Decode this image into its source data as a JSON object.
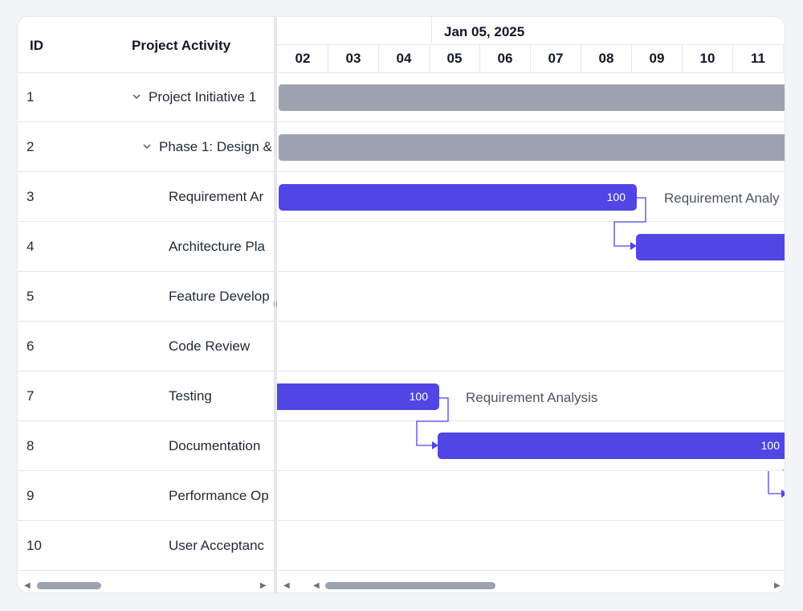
{
  "grid": {
    "columns": {
      "id": "ID",
      "name": "Project Activity"
    },
    "rows": [
      {
        "id": "1",
        "name": "Project Initiative 1",
        "level": 0,
        "expand": "chevron-down"
      },
      {
        "id": "2",
        "name": "Phase 1: Design &",
        "level": 1,
        "expand": "chevron-down"
      },
      {
        "id": "3",
        "name": "Requirement Ar",
        "level": 2
      },
      {
        "id": "4",
        "name": "Architecture Pla",
        "level": 2
      },
      {
        "id": "5",
        "name": "Feature Develop",
        "level": 2
      },
      {
        "id": "6",
        "name": "Code Review",
        "level": 2
      },
      {
        "id": "7",
        "name": "Testing",
        "level": 2
      },
      {
        "id": "8",
        "name": "Documentation",
        "level": 2
      },
      {
        "id": "9",
        "name": "Performance Op",
        "level": 2
      },
      {
        "id": "10",
        "name": "User Acceptanc",
        "level": 2
      }
    ]
  },
  "splitter": {
    "grip": "II"
  },
  "timeline": {
    "week": "Jan 05, 2025",
    "days": [
      "02",
      "03",
      "04",
      "05",
      "06",
      "07",
      "08",
      "09",
      "10",
      "11"
    ]
  },
  "tasks": [
    {
      "row": 1,
      "type": "summary"
    },
    {
      "row": 2,
      "type": "summary"
    },
    {
      "row": 3,
      "type": "task",
      "progress": "100",
      "label": "Requirement Analy"
    },
    {
      "row": 4,
      "type": "task"
    },
    {
      "row": 7,
      "type": "task",
      "progress": "100",
      "label": "Requirement Analysis"
    },
    {
      "row": 8,
      "type": "task",
      "progress": "100"
    },
    {
      "row": 9,
      "type": "task"
    }
  ],
  "colors": {
    "task": "#4f46e5",
    "summary": "#9ca3af",
    "connector": "#4f46e5",
    "border": "#e5e7eb"
  },
  "icons": {
    "expand": "chevron-down-icon",
    "scroll_left": "arrow-left-icon",
    "scroll_right": "arrow-right-icon"
  },
  "scrollbars": {
    "left_arrow": "◀",
    "right_arrow": "▶"
  }
}
